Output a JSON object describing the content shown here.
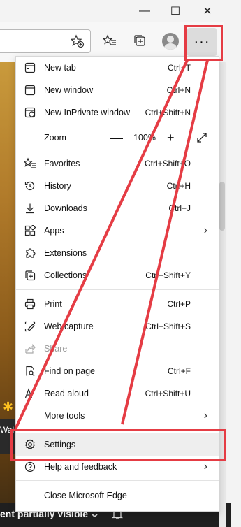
{
  "window": {
    "minimize_glyph": "—",
    "maximize_glyph": "☐",
    "close_glyph": "✕"
  },
  "toolbar": {
    "more_glyph": "···"
  },
  "page": {
    "text_fragment": "Wali",
    "bottom_banner": "ent partially visible"
  },
  "menu": {
    "items": [
      {
        "label": "New tab",
        "shortcut": "Ctrl+T",
        "icon": "new-tab-icon"
      },
      {
        "label": "New window",
        "shortcut": "Ctrl+N",
        "icon": "new-window-icon"
      },
      {
        "label": "New InPrivate window",
        "shortcut": "Ctrl+Shift+N",
        "icon": "inprivate-icon"
      },
      {
        "label": "Favorites",
        "shortcut": "Ctrl+Shift+O",
        "icon": "favorites-icon"
      },
      {
        "label": "History",
        "shortcut": "Ctrl+H",
        "icon": "history-icon"
      },
      {
        "label": "Downloads",
        "shortcut": "Ctrl+J",
        "icon": "downloads-icon"
      },
      {
        "label": "Apps",
        "shortcut": "",
        "icon": "apps-icon"
      },
      {
        "label": "Extensions",
        "shortcut": "",
        "icon": "extensions-icon"
      },
      {
        "label": "Collections",
        "shortcut": "Ctrl+Shift+Y",
        "icon": "collections-icon"
      },
      {
        "label": "Print",
        "shortcut": "Ctrl+P",
        "icon": "print-icon"
      },
      {
        "label": "Web capture",
        "shortcut": "Ctrl+Shift+S",
        "icon": "web-capture-icon"
      },
      {
        "label": "Share",
        "shortcut": "",
        "icon": "share-icon"
      },
      {
        "label": "Find on page",
        "shortcut": "Ctrl+F",
        "icon": "find-icon"
      },
      {
        "label": "Read aloud",
        "shortcut": "Ctrl+Shift+U",
        "icon": "read-aloud-icon"
      },
      {
        "label": "More tools",
        "shortcut": "",
        "icon": ""
      },
      {
        "label": "Settings",
        "shortcut": "",
        "icon": "settings-icon"
      },
      {
        "label": "Help and feedback",
        "shortcut": "",
        "icon": "help-icon"
      },
      {
        "label": "Close Microsoft Edge",
        "shortcut": "",
        "icon": ""
      }
    ],
    "zoom": {
      "label": "Zoom",
      "value": "100%",
      "minus": "—",
      "plus": "+"
    }
  },
  "colors": {
    "highlight": "#e53c44"
  }
}
